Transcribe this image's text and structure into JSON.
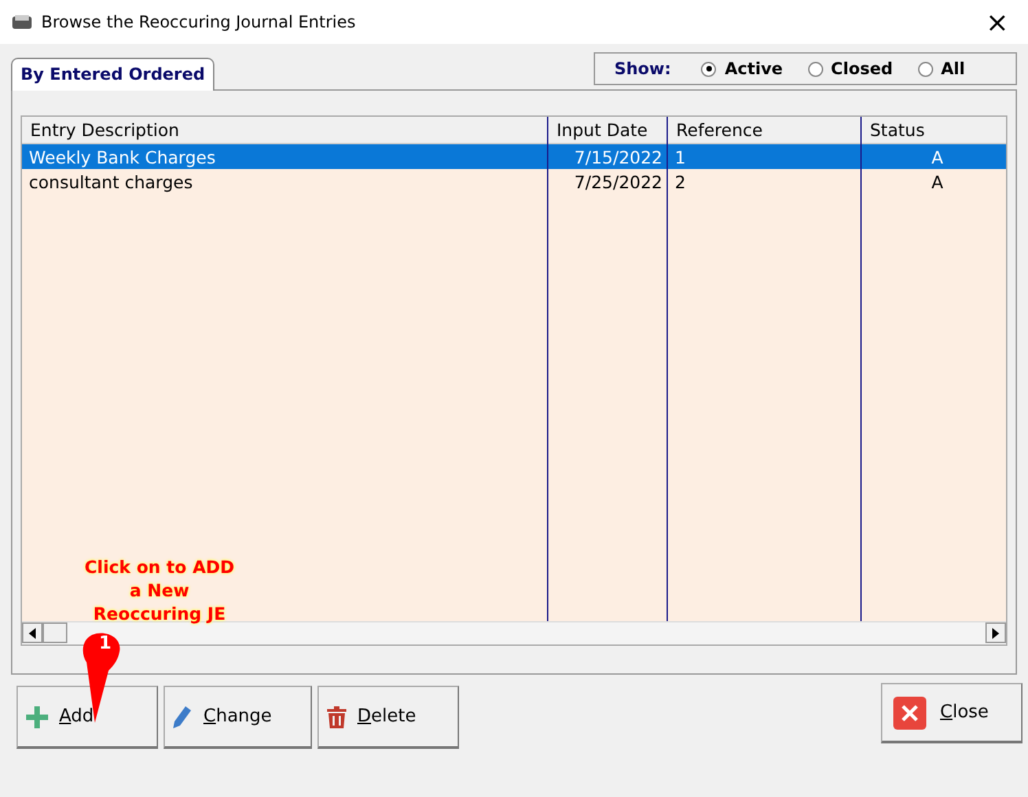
{
  "window": {
    "title": "Browse the Reoccuring Journal Entries",
    "close": "×"
  },
  "tabs": [
    {
      "label": "By Entered Ordered",
      "selected": true
    }
  ],
  "show_filter": {
    "label": "Show:",
    "options": [
      {
        "label": "Active",
        "selected": true
      },
      {
        "label": "Closed",
        "selected": false
      },
      {
        "label": "All",
        "selected": false
      }
    ]
  },
  "table": {
    "columns": [
      "Entry Description",
      "Input Date",
      "Reference",
      "Status"
    ],
    "rows": [
      {
        "cells": [
          "Weekly Bank Charges",
          "7/15/2022",
          "1",
          "A"
        ],
        "selected": true
      },
      {
        "cells": [
          "consultant charges",
          "7/25/2022",
          "2",
          "A"
        ],
        "selected": false
      }
    ]
  },
  "annotation": {
    "text": "Click on to ADD a New Reoccuring JE",
    "badge": "1"
  },
  "buttons": [
    {
      "label": "Add",
      "kind": "add"
    },
    {
      "label": "Change",
      "kind": "change"
    },
    {
      "label": "Delete",
      "kind": "delete"
    },
    {
      "label": "Close",
      "kind": "close"
    }
  ]
}
